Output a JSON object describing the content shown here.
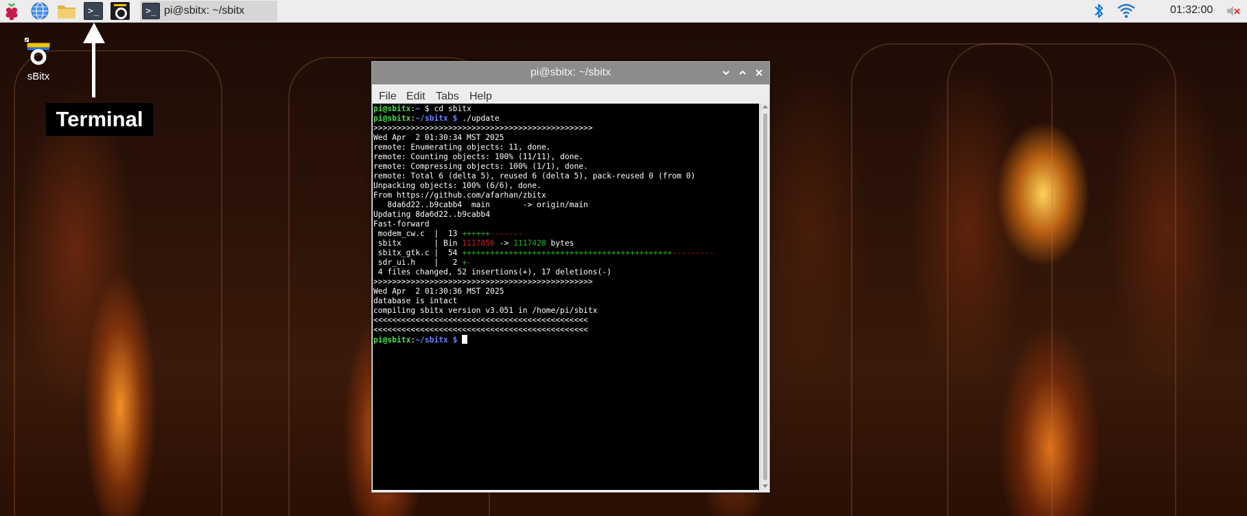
{
  "taskbar": {
    "launchers": [
      {
        "name": "raspberry-menu-icon"
      },
      {
        "name": "web-browser-icon"
      },
      {
        "name": "file-manager-icon"
      },
      {
        "name": "terminal-launcher-icon",
        "glyph": ">_"
      },
      {
        "name": "sbitx-launcher-icon"
      }
    ],
    "task_button": {
      "label": "pi@sbitx: ~/sbitx"
    },
    "tray": {
      "bluetooth_icon": "bluetooth-icon",
      "wifi_icon": "wifi-icon",
      "clock": "01:32:00",
      "volume_icon": "volume-muted-icon"
    }
  },
  "desktop": {
    "icon_label": "sBitx",
    "annotation": "Terminal"
  },
  "window": {
    "title": "pi@sbitx: ~/sbitx",
    "menu": [
      "File",
      "Edit",
      "Tabs",
      "Help"
    ],
    "prompt_user": "pi@sbitx",
    "terminal": {
      "l1_path": "~",
      "l1_cmd": "cd sbitx",
      "l2_path": "~/sbitx",
      "l2_cmd": "./update",
      "l3": ">>>>>>>>>>>>>>>>>>>>>>>>>>>>>>>>>>>>>>>>>>>>>>>",
      "l4": "Wed Apr  2 01:30:34 MST 2025",
      "l5": "remote: Enumerating objects: 11, done.",
      "l6": "remote: Counting objects: 100% (11/11), done.",
      "l7": "remote: Compressing objects: 100% (1/1), done.",
      "l8": "remote: Total 6 (delta 5), reused 6 (delta 5), pack-reused 0 (from 0)",
      "l9": "Unpacking objects: 100% (6/6), done.",
      "l10": "From https://github.com/afarhan/zbitx",
      "l11": "   8da6d22..b9cabb4  main       -> origin/main",
      "l12": "Updating 8da6d22..b9cabb4",
      "l13": "Fast-forward",
      "l14a": " modem_cw.c  |  13 ",
      "l14b": "++++++",
      "l14c": "-------",
      "l15a": " sbitx       | Bin ",
      "l15b": "1117056",
      "l15c": " -> ",
      "l15d": "1117428",
      "l15e": " bytes",
      "l16a": " sbitx_gtk.c |  54 ",
      "l16b": "+++++++++++++++++++++++++++++++++++++++++++++",
      "l16c": "---------",
      "l17a": " sdr_ui.h    |   2 ",
      "l17b": "+",
      "l17c": "-",
      "l18": " 4 files changed, 52 insertions(+), 17 deletions(-)",
      "l19": ">>>>>>>>>>>>>>>>>>>>>>>>>>>>>>>>>>>>>>>>>>>>>>>",
      "l20": "Wed Apr  2 01:30:36 MST 2025",
      "l21": "database is intact",
      "l22": "compiling sbitx version v3.051 in /home/pi/sbitx",
      "l23": "<<<<<<<<<<<<<<<<<<<<<<<<<<<<<<<<<<<<<<<<<<<<<<",
      "l24": "<<<<<<<<<<<<<<<<<<<<<<<<<<<<<<<<<<<<<<<<<<<<<<",
      "l25_path": "~/sbitx"
    }
  }
}
